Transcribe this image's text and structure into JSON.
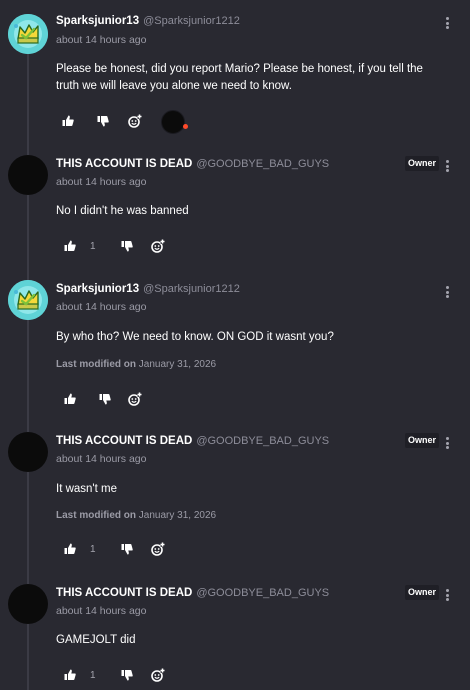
{
  "comments": [
    {
      "username": "Sparksjunior13",
      "handle": "@Sparksjunior1212",
      "time": "about 14 hours ago",
      "text": "Please be honest, did you report Mario? Please be honest, if you tell the truth we will leave you alone we need to know.",
      "owner_badge": "",
      "modified_label": "",
      "modified_date": "",
      "like_count": ""
    },
    {
      "username": "THIS ACCOUNT IS DEAD",
      "handle": "@GOODBYE_BAD_GUYS",
      "time": "about 14 hours ago",
      "text": "No I didn't he was banned",
      "owner_badge": "Owner",
      "modified_label": "",
      "modified_date": "",
      "like_count": "1"
    },
    {
      "username": "Sparksjunior13",
      "handle": "@Sparksjunior1212",
      "time": "about 14 hours ago",
      "text": "By who tho? We need to know. ON GOD it wasnt you?",
      "owner_badge": "",
      "modified_label": "Last modified on",
      "modified_date": "January 31, 2026",
      "like_count": ""
    },
    {
      "username": "THIS ACCOUNT IS DEAD",
      "handle": "@GOODBYE_BAD_GUYS",
      "time": "about 14 hours ago",
      "text": "It wasn't me",
      "owner_badge": "Owner",
      "modified_label": "Last modified on",
      "modified_date": "January 31, 2026",
      "like_count": "1"
    },
    {
      "username": "THIS ACCOUNT IS DEAD",
      "handle": "@GOODBYE_BAD_GUYS",
      "time": "about 14 hours ago",
      "text": "GAMEJOLT did",
      "owner_badge": "Owner",
      "modified_label": "",
      "modified_date": "",
      "like_count": "1"
    }
  ],
  "icons": {
    "like": "thumbs-up-icon",
    "dislike": "thumbs-down-icon",
    "react": "add-reaction-icon",
    "menu": "more-vertical-icon"
  },
  "colors": {
    "background": "#292931",
    "reaction_dot": "#ff4a2a",
    "avatar_teal": "#5fd3d6"
  }
}
